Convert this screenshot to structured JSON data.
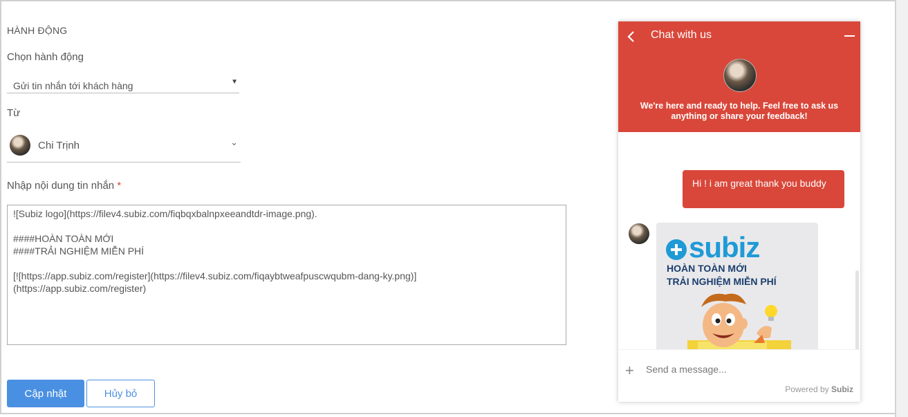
{
  "form": {
    "section_title": "HÀNH ĐỘNG",
    "action_label": "Chọn hành động",
    "action_value": "Gửi tin nhắn tới khách hàng",
    "from_label": "Từ",
    "from_value": "Chi Trịnh",
    "message_label": "Nhập nội dung tin nhắn",
    "required_mark": "*",
    "message_value": "![Subiz logo](https://filev4.subiz.com/fiqbqxbalnpxeeandtdr-image.png).\n\n####HOÀN TOÀN MỚI\n####TRẢI NGHIỆM MIỄN PHÍ\n\n[![https://app.subiz.com/register](https://filev4.subiz.com/fiqaybtweafpuscwqubm-dang-ky.png)]\n(https://app.subiz.com/register)"
  },
  "buttons": {
    "update": "Cập nhật",
    "cancel": "Hủy bỏ"
  },
  "chat": {
    "title": "Chat with us",
    "welcome": "We're here and ready to help. Feel free to ask us anything or share your feedback!",
    "user_message": "Hi ! i am great thank you buddy",
    "card": {
      "logo_text": "subiz",
      "line1": "HOÀN TOÀN MỚI",
      "line2": "TRẢI NGHIỆM MIỄN PHÍ"
    },
    "input_placeholder": "Send a message...",
    "powered_by": "Powered by",
    "brand": "Subiz",
    "header_color": "#d9473a",
    "icons": [
      "back-icon",
      "minimize-icon",
      "plus-icon"
    ]
  }
}
